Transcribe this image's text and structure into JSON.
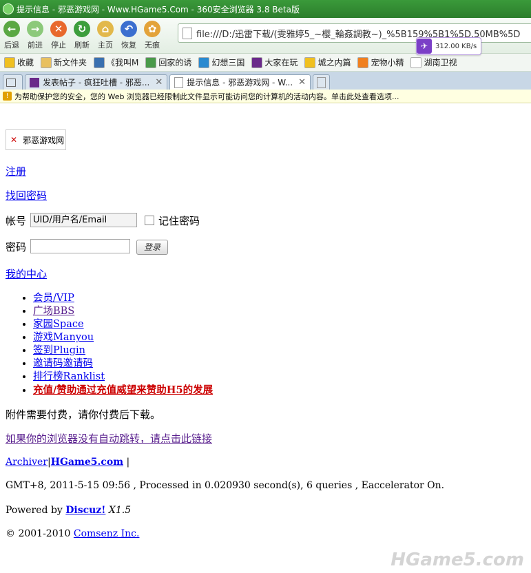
{
  "window": {
    "title": "提示信息 - 邪恶游戏网 - Www.HGame5.Com - 360安全浏览器 3.8 Beta版"
  },
  "toolbar": {
    "buttons": [
      {
        "label": "后退",
        "color": "#5aa843",
        "glyph": "←"
      },
      {
        "label": "前进",
        "color": "#8cc97a",
        "glyph": "→"
      },
      {
        "label": "停止",
        "color": "#e8692c",
        "glyph": "✕"
      },
      {
        "label": "刷新",
        "color": "#3c9e3c",
        "glyph": "↻"
      },
      {
        "label": "主页",
        "color": "#e2b84a",
        "glyph": "⌂"
      },
      {
        "label": "恢复",
        "color": "#3b6fcf",
        "glyph": "↶"
      },
      {
        "label": "无痕",
        "color": "#e3a33a",
        "glyph": "✿"
      }
    ],
    "address": "file:///D:/迅雷下载/(雯雅婷5_~樱_輪姦調教~)_%5B159%5B1%5D.50MB%5D",
    "speed": "312.00 KB/s"
  },
  "favorites": [
    {
      "label": "收藏",
      "color": "#f0c020"
    },
    {
      "label": "新文件夹",
      "color": "#e8c060"
    },
    {
      "label": "《我叫M",
      "color": "#3a70b0"
    },
    {
      "label": "回家的诱",
      "color": "#4a9a4a"
    },
    {
      "label": "幻想三国",
      "color": "#2a8ad0"
    },
    {
      "label": "大家在玩",
      "color": "#6a2a8a"
    },
    {
      "label": "城之内篇",
      "color": "#f0c020"
    },
    {
      "label": "宠物小精",
      "color": "#f08020"
    },
    {
      "label": "湖南卫视",
      "color": "#ffffff"
    }
  ],
  "tabs": [
    {
      "label": "发表帖子 - 疯狂吐槽 - 邪恶...",
      "close": "✕"
    },
    {
      "label": "提示信息 - 邪恶游戏网 - W...",
      "close": "✕"
    }
  ],
  "infobar": {
    "text": "为帮助保护您的安全，您的 Web 浏览器已经限制此文件显示可能访问您的计算机的活动内容。单击此处查看选项..."
  },
  "page": {
    "logo_alt": "邪恶游戏网",
    "register": "注册",
    "recover": "找回密码",
    "account_label": "帐号",
    "account_value": "UID/用户名/Email",
    "remember": "记住密码",
    "password_label": "密码",
    "login": "登录",
    "my_center": "我的中心",
    "menu": [
      "会员/VIP",
      "广场BBS",
      "家园Space",
      "游戏Manyou",
      "签到Plugin",
      "邀请码邀请码",
      "排行榜Ranklist"
    ],
    "menu_highlight": "充值/赞助通过充值威望来赞助H5的发展",
    "message": "附件需要付费，请你付费后下载。",
    "redirect": "如果你的浏览器没有自动跳转，请点击此链接",
    "footer_archiver": "Archiver",
    "footer_sep": "|",
    "footer_site": "HGame5.com",
    "footer_sep2": " |",
    "processed": "GMT+8, 2011-5-15 09:56 , Processed in 0.020930 second(s), 6 queries , Eaccelerator On.",
    "powered_prefix": "Powered by ",
    "powered_name": "Discuz!",
    "powered_ver": " X1.5",
    "copyright_prefix": "© 2001-2010 ",
    "copyright_name": "Comsenz Inc."
  },
  "watermark": "HGame5.com"
}
